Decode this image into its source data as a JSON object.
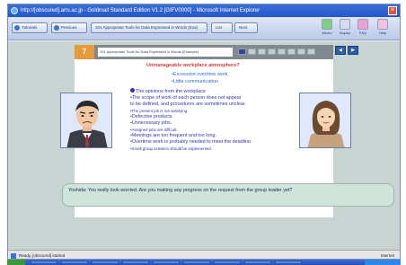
{
  "window": {
    "title": "http://[obscured].arts.ac.jp - Goldmail Standard Edition V1.2 [GIFV0000] - Microsoft Internet Explorer"
  },
  "toolbar": {
    "tutorial_label": "Tutorials",
    "previous_label": "Previous",
    "breadcrumb": "101 Appropriate Tools for Data Expressed in Words (Exa)",
    "list_label": "List",
    "next_label": "Next",
    "icons": [
      {
        "label": "Memo",
        "icon": "memo-icon"
      },
      {
        "label": "Inquiry",
        "icon": "inquiry-icon"
      },
      {
        "label": "FAQ",
        "icon": "faq-icon"
      },
      {
        "label": "Help",
        "icon": "help-icon"
      }
    ]
  },
  "slide": {
    "number": "7",
    "title": "101 Appropriate Tools for Data Expressed in Words (Example)",
    "question": "Unmanageable workplace atmosphere?",
    "points": [
      "•Excessive overtime work",
      "•Little communication"
    ],
    "opinions": [
      {
        "text": "The opinions from the workplace",
        "small": false
      },
      {
        "text": "•The scope of work of each person does not appear",
        "small": false
      },
      {
        "text": "  to be defined, and procedures are sometimes unclear.",
        "small": false
      },
      {
        "text": "•The present job is not satisfying.",
        "small": true
      },
      {
        "text": "•Defective products",
        "small": false
      },
      {
        "text": "•Unnecessary jobs.",
        "small": false
      },
      {
        "text": "•Assigned jobs are difficult.",
        "small": true
      },
      {
        "text": "•Meetings are too frequent and too long.",
        "small": false
      },
      {
        "text": "•Overtime work is probably needed to meet the deadline.",
        "small": false
      },
      {
        "text": "•Small group activities should be implemented.",
        "small": true
      }
    ],
    "nav_prev": "◀",
    "nav_next": "▶"
  },
  "dialog": {
    "text": "Yoshida: You really look worried. Are you making any progress on the request from the group leader yet?"
  },
  "status": {
    "text": "Ready, [obscured] started",
    "zone": "Internet"
  },
  "colors": {
    "titlebar": "#2457c8",
    "slide_tab": "#e79a3c",
    "question": "#d23b3b",
    "bullet_blue": "#2a6fcf",
    "opinion_text": "#3333aa"
  }
}
